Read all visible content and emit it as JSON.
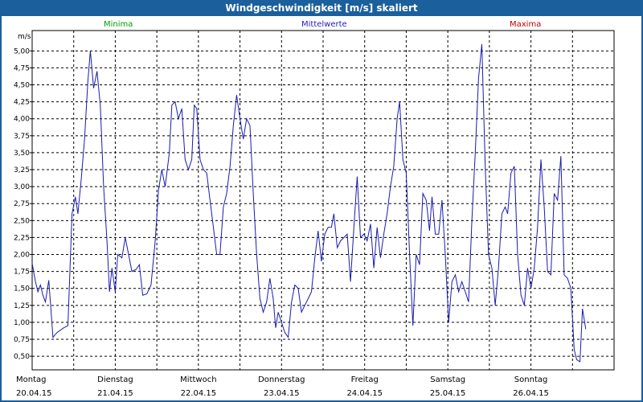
{
  "window": {
    "title": "Windgeschwindigkeit [m/s] skaliert"
  },
  "colors": {
    "minima": "#00a000",
    "mittelwerte": "#2020c0",
    "maxima": "#c00000",
    "line": "#1a1ab0",
    "frame": "#1b5f9c"
  },
  "chart_data": {
    "type": "line",
    "title": "Windgeschwindigkeit [m/s] skaliert",
    "ylabel": "m/s",
    "ylim": [
      0.3,
      5.3
    ],
    "yticks": [
      "0,50",
      "0,75",
      "1,00",
      "1,25",
      "1,50",
      "1,75",
      "2,00",
      "2,25",
      "2,50",
      "2,75",
      "3,00",
      "3,25",
      "3,50",
      "3,75",
      "4,00",
      "4,25",
      "4,50",
      "4,75",
      "5,00"
    ],
    "x_range": [
      0,
      7
    ],
    "x_unit": "days from 20.04.15",
    "xticks": [
      {
        "day": "Montag",
        "date": "20.04.15"
      },
      {
        "day": "Dienstag",
        "date": "21.04.15"
      },
      {
        "day": "Mittwoch",
        "date": "22.04.15"
      },
      {
        "day": "Donnerstag",
        "date": "23.04.15"
      },
      {
        "day": "Freitag",
        "date": "24.04.15"
      },
      {
        "day": "Samstag",
        "date": "25.04.15"
      },
      {
        "day": "Sonntag",
        "date": "26.04.15"
      }
    ],
    "legend": [
      {
        "name": "Minima",
        "color": "#00a000"
      },
      {
        "name": "Mittelwerte",
        "color": "#2020c0"
      },
      {
        "name": "Maxima",
        "color": "#c00000"
      }
    ],
    "grid": true,
    "series": [
      {
        "name": "Mittelwerte",
        "color": "#1a1ab0",
        "points": [
          [
            0.0,
            1.87
          ],
          [
            0.04,
            1.6
          ],
          [
            0.07,
            1.45
          ],
          [
            0.1,
            1.55
          ],
          [
            0.13,
            1.4
          ],
          [
            0.16,
            1.3
          ],
          [
            0.2,
            1.62
          ],
          [
            0.25,
            0.78
          ],
          [
            0.3,
            0.85
          ],
          [
            0.38,
            0.92
          ],
          [
            0.43,
            0.95
          ],
          [
            0.48,
            2.6
          ],
          [
            0.52,
            2.85
          ],
          [
            0.55,
            2.6
          ],
          [
            0.59,
            3.1
          ],
          [
            0.63,
            3.7
          ],
          [
            0.67,
            4.55
          ],
          [
            0.7,
            5.0
          ],
          [
            0.74,
            4.45
          ],
          [
            0.78,
            4.7
          ],
          [
            0.82,
            4.2
          ],
          [
            0.86,
            3.0
          ],
          [
            0.9,
            2.2
          ],
          [
            0.93,
            1.45
          ],
          [
            0.96,
            1.8
          ],
          [
            1.0,
            1.45
          ],
          [
            1.03,
            2.0
          ],
          [
            1.08,
            1.95
          ],
          [
            1.12,
            2.25
          ],
          [
            1.16,
            2.0
          ],
          [
            1.2,
            1.75
          ],
          [
            1.25,
            1.78
          ],
          [
            1.29,
            1.85
          ],
          [
            1.33,
            1.4
          ],
          [
            1.38,
            1.42
          ],
          [
            1.43,
            1.55
          ],
          [
            1.48,
            2.2
          ],
          [
            1.52,
            2.95
          ],
          [
            1.56,
            3.25
          ],
          [
            1.6,
            3.0
          ],
          [
            1.65,
            3.5
          ],
          [
            1.68,
            4.2
          ],
          [
            1.72,
            4.25
          ],
          [
            1.76,
            4.0
          ],
          [
            1.8,
            4.15
          ],
          [
            1.84,
            3.4
          ],
          [
            1.88,
            3.25
          ],
          [
            1.92,
            3.4
          ],
          [
            1.95,
            4.2
          ],
          [
            1.98,
            4.15
          ],
          [
            2.02,
            3.4
          ],
          [
            2.06,
            3.25
          ],
          [
            2.1,
            3.2
          ],
          [
            2.14,
            2.8
          ],
          [
            2.18,
            2.4
          ],
          [
            2.22,
            2.0
          ],
          [
            2.26,
            2.0
          ],
          [
            2.3,
            2.7
          ],
          [
            2.34,
            2.9
          ],
          [
            2.38,
            3.3
          ],
          [
            2.42,
            3.9
          ],
          [
            2.46,
            4.35
          ],
          [
            2.5,
            4.0
          ],
          [
            2.54,
            3.7
          ],
          [
            2.58,
            4.0
          ],
          [
            2.62,
            3.9
          ],
          [
            2.66,
            2.9
          ],
          [
            2.7,
            2.0
          ],
          [
            2.74,
            1.35
          ],
          [
            2.78,
            1.15
          ],
          [
            2.82,
            1.3
          ],
          [
            2.86,
            1.65
          ],
          [
            2.9,
            1.35
          ],
          [
            2.93,
            0.92
          ],
          [
            2.96,
            1.15
          ],
          [
            3.0,
            1.0
          ],
          [
            3.04,
            0.85
          ],
          [
            3.08,
            0.78
          ],
          [
            3.12,
            1.3
          ],
          [
            3.16,
            1.55
          ],
          [
            3.2,
            1.5
          ],
          [
            3.24,
            1.15
          ],
          [
            3.28,
            1.25
          ],
          [
            3.32,
            1.35
          ],
          [
            3.36,
            1.45
          ],
          [
            3.4,
            1.95
          ],
          [
            3.44,
            2.35
          ],
          [
            3.48,
            1.9
          ],
          [
            3.52,
            2.3
          ],
          [
            3.56,
            2.4
          ],
          [
            3.6,
            2.4
          ],
          [
            3.63,
            2.6
          ],
          [
            3.67,
            2.1
          ],
          [
            3.71,
            2.2
          ],
          [
            3.75,
            2.25
          ],
          [
            3.79,
            2.3
          ],
          [
            3.83,
            1.6
          ],
          [
            3.87,
            2.4
          ],
          [
            3.91,
            3.15
          ],
          [
            3.95,
            2.25
          ],
          [
            3.99,
            2.3
          ],
          [
            4.03,
            2.2
          ],
          [
            4.07,
            2.45
          ],
          [
            4.11,
            1.8
          ],
          [
            4.15,
            2.4
          ],
          [
            4.19,
            1.95
          ],
          [
            4.23,
            2.3
          ],
          [
            4.27,
            2.6
          ],
          [
            4.31,
            3.0
          ],
          [
            4.35,
            3.3
          ],
          [
            4.39,
            4.0
          ],
          [
            4.42,
            4.25
          ],
          [
            4.46,
            3.4
          ],
          [
            4.5,
            3.2
          ],
          [
            4.54,
            2.0
          ],
          [
            4.58,
            0.95
          ],
          [
            4.62,
            2.0
          ],
          [
            4.66,
            1.85
          ],
          [
            4.7,
            2.9
          ],
          [
            4.74,
            2.8
          ],
          [
            4.78,
            2.35
          ],
          [
            4.81,
            2.85
          ],
          [
            4.85,
            2.3
          ],
          [
            4.89,
            2.3
          ],
          [
            4.93,
            2.8
          ],
          [
            4.97,
            2.0
          ],
          [
            5.01,
            1.0
          ],
          [
            5.05,
            1.6
          ],
          [
            5.09,
            1.7
          ],
          [
            5.13,
            1.45
          ],
          [
            5.17,
            1.6
          ],
          [
            5.21,
            1.45
          ],
          [
            5.25,
            1.3
          ],
          [
            5.29,
            2.5
          ],
          [
            5.33,
            3.5
          ],
          [
            5.37,
            4.6
          ],
          [
            5.41,
            5.1
          ],
          [
            5.45,
            3.3
          ],
          [
            5.49,
            2.0
          ],
          [
            5.53,
            1.8
          ],
          [
            5.57,
            1.25
          ],
          [
            5.61,
            1.8
          ],
          [
            5.65,
            2.6
          ],
          [
            5.69,
            2.7
          ],
          [
            5.72,
            2.6
          ],
          [
            5.76,
            3.2
          ],
          [
            5.8,
            3.3
          ],
          [
            5.84,
            2.0
          ],
          [
            5.88,
            1.4
          ],
          [
            5.92,
            1.25
          ],
          [
            5.96,
            1.8
          ],
          [
            6.0,
            1.5
          ],
          [
            6.04,
            1.8
          ],
          [
            6.08,
            2.4
          ],
          [
            6.12,
            3.4
          ],
          [
            6.16,
            2.7
          ],
          [
            6.2,
            1.75
          ],
          [
            6.24,
            1.7
          ],
          [
            6.28,
            2.9
          ],
          [
            6.32,
            2.8
          ],
          [
            6.36,
            3.45
          ],
          [
            6.4,
            1.7
          ],
          [
            6.44,
            1.65
          ],
          [
            6.48,
            1.5
          ],
          [
            6.52,
            0.6
          ],
          [
            6.55,
            0.45
          ],
          [
            6.59,
            0.42
          ],
          [
            6.62,
            1.2
          ],
          [
            6.66,
            0.9
          ]
        ]
      }
    ]
  }
}
